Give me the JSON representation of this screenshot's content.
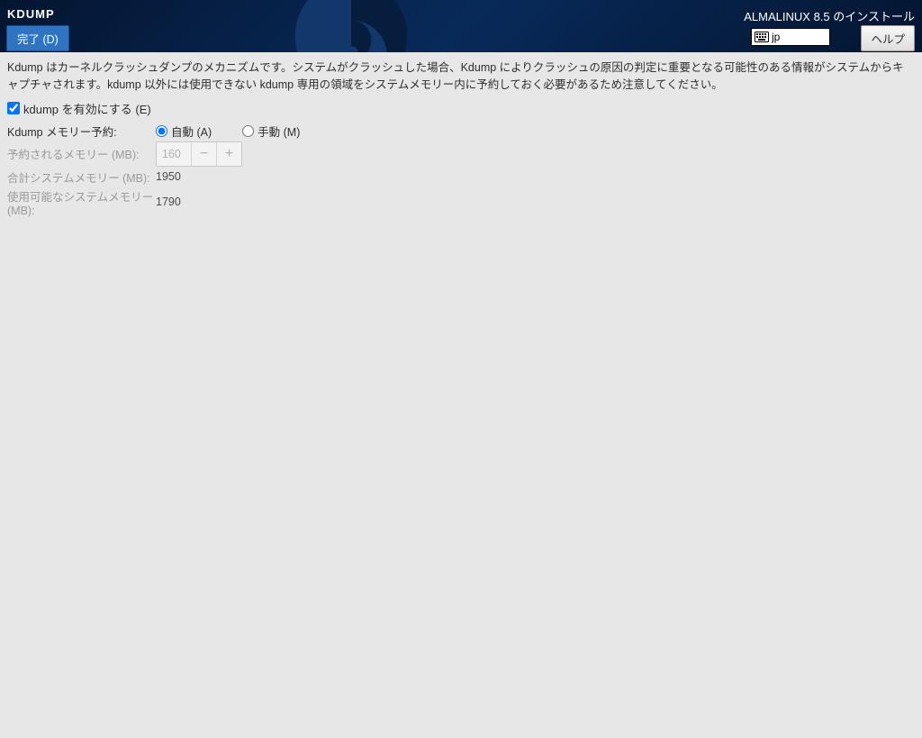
{
  "header": {
    "page_title": "KDUMP",
    "done_label": "完了 (D)",
    "install_title": "ALMALINUX 8.5 のインストール",
    "keyboard_layout": "jp",
    "help_label": "ヘルプ"
  },
  "body": {
    "description": "Kdump はカーネルクラッシュダンプのメカニズムです。システムがクラッシュした場合、Kdump によりクラッシュの原因の判定に重要となる可能性のある情報がシステムからキャプチャされます。kdump 以外には使用できない kdump 専用の領域をシステムメモリー内に予約しておく必要があるため注意してください。",
    "enable_kdump": {
      "label": "kdump を有効にする (E)",
      "checked": true
    },
    "memory_reservation": {
      "label": "Kdump メモリー予約:",
      "auto_label": "自動 (A)",
      "manual_label": "手動 (M)",
      "selected": "auto"
    },
    "reserved_memory": {
      "label": "予約されるメモリー (MB):",
      "value": "160"
    },
    "total_memory": {
      "label": "合計システムメモリー (MB):",
      "value": "1950"
    },
    "usable_memory": {
      "label": "使用可能なシステムメモリー (MB):",
      "value": "1790"
    },
    "spin": {
      "minus": "−",
      "plus": "+"
    }
  }
}
